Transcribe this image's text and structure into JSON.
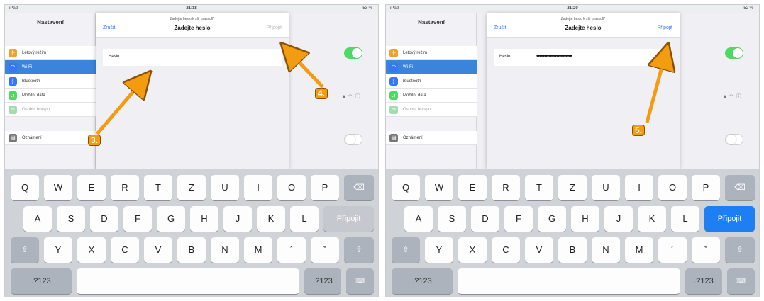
{
  "panels": [
    {
      "status": {
        "carrier": "iPad",
        "time": "21:18",
        "battery": "53 %"
      },
      "settings": {
        "title": "Nastavení",
        "rows": [
          {
            "label": "Letový režim",
            "icon": "airplane-icon",
            "color": "#f0a030"
          },
          {
            "label": "Wi-Fi",
            "icon": "wifi-icon",
            "color": "#3478f6"
          },
          {
            "label": "Bluetooth",
            "icon": "bluetooth-icon",
            "color": "#3478f6"
          },
          {
            "label": "Mobilní data",
            "icon": "cellular-icon",
            "color": "#4cd964"
          },
          {
            "label": "Osobní hotspot",
            "icon": "hotspot-icon",
            "color": "#4cd964"
          },
          {
            "label": "Oznámení",
            "icon": "notifications-icon",
            "color": "#777777"
          }
        ]
      },
      "modal": {
        "subtitle": "Zadejte heslo k síti „nassoff\"",
        "cancel": "Zrušit",
        "title": "Zadejte heslo",
        "join": "Připojit",
        "join_enabled": false,
        "field_label": "Heslo",
        "field_value": ""
      },
      "callouts": [
        "3.",
        "4."
      ],
      "keyboard": {
        "row1": [
          "Q",
          "W",
          "E",
          "R",
          "T",
          "Z",
          "U",
          "I",
          "O",
          "P"
        ],
        "row2": [
          "A",
          "S",
          "D",
          "F",
          "G",
          "H",
          "J",
          "K",
          "L"
        ],
        "row3": [
          "Y",
          "X",
          "C",
          "V",
          "B",
          "N",
          "M",
          "´",
          "ˇ"
        ],
        "join": "Připojit",
        "numbers": ".?123"
      }
    },
    {
      "status": {
        "carrier": "iPad",
        "time": "21:20",
        "battery": "52 %"
      },
      "settings": {
        "title": "Nastavení",
        "rows": [
          {
            "label": "Letový režim",
            "icon": "airplane-icon",
            "color": "#f0a030"
          },
          {
            "label": "Wi-Fi",
            "icon": "wifi-icon",
            "color": "#3478f6"
          },
          {
            "label": "Bluetooth",
            "icon": "bluetooth-icon",
            "color": "#3478f6"
          },
          {
            "label": "Mobilní data",
            "icon": "cellular-icon",
            "color": "#4cd964"
          },
          {
            "label": "Osobní hotspot",
            "icon": "hotspot-icon",
            "color": "#4cd964"
          },
          {
            "label": "Oznámení",
            "icon": "notifications-icon",
            "color": "#777777"
          }
        ]
      },
      "modal": {
        "subtitle": "Zadejte heslo k síti „nassoff\"",
        "cancel": "Zrušit",
        "title": "Zadejte heslo",
        "join": "Připojit",
        "join_enabled": true,
        "field_label": "Heslo",
        "field_value": "•••••••••••••••••••••••"
      },
      "callouts": [
        "5."
      ],
      "keyboard": {
        "row1": [
          "Q",
          "W",
          "E",
          "R",
          "T",
          "Z",
          "U",
          "I",
          "O",
          "P"
        ],
        "row2": [
          "A",
          "S",
          "D",
          "F",
          "G",
          "H",
          "J",
          "K",
          "L"
        ],
        "row3": [
          "Y",
          "X",
          "C",
          "V",
          "B",
          "N",
          "M",
          "´",
          "ˇ"
        ],
        "join": "Připojit",
        "numbers": ".?123"
      }
    }
  ],
  "colors": {
    "accent": "#3478f6",
    "arrow": "#f39c12",
    "toggle_on": "#4cd964"
  }
}
